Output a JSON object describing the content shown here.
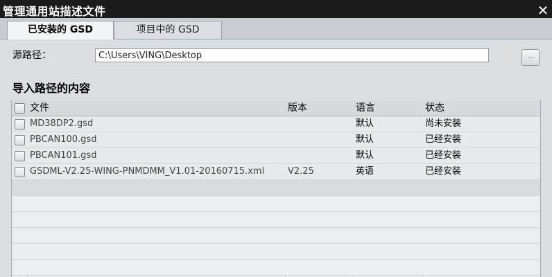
{
  "window": {
    "title": "管理通用站描述文件",
    "close_glyph": "✕"
  },
  "tabs": [
    {
      "label": "已安装的 GSD",
      "active": true
    },
    {
      "label": "项目中的 GSD",
      "active": false
    }
  ],
  "source": {
    "label": "源路径：",
    "value": "C:\\Users\\VING\\Desktop",
    "browse_label": "..."
  },
  "section_title": "导入路径的内容",
  "table": {
    "columns": [
      "文件",
      "版本",
      "语言",
      "状态"
    ],
    "rows": [
      {
        "file": "MD38DP2.gsd",
        "version": "",
        "language": "默认",
        "status": "尚未安装"
      },
      {
        "file": "PBCAN100.gsd",
        "version": "",
        "language": "默认",
        "status": "已经安装"
      },
      {
        "file": "PBCAN101.gsd",
        "version": "",
        "language": "默认",
        "status": "已经安装"
      },
      {
        "file": "GSDML-V2.25-WING-PNMDMM_V1.01-20160715.xml",
        "version": "V2.25",
        "language": "英语",
        "status": "已经安装"
      }
    ]
  }
}
